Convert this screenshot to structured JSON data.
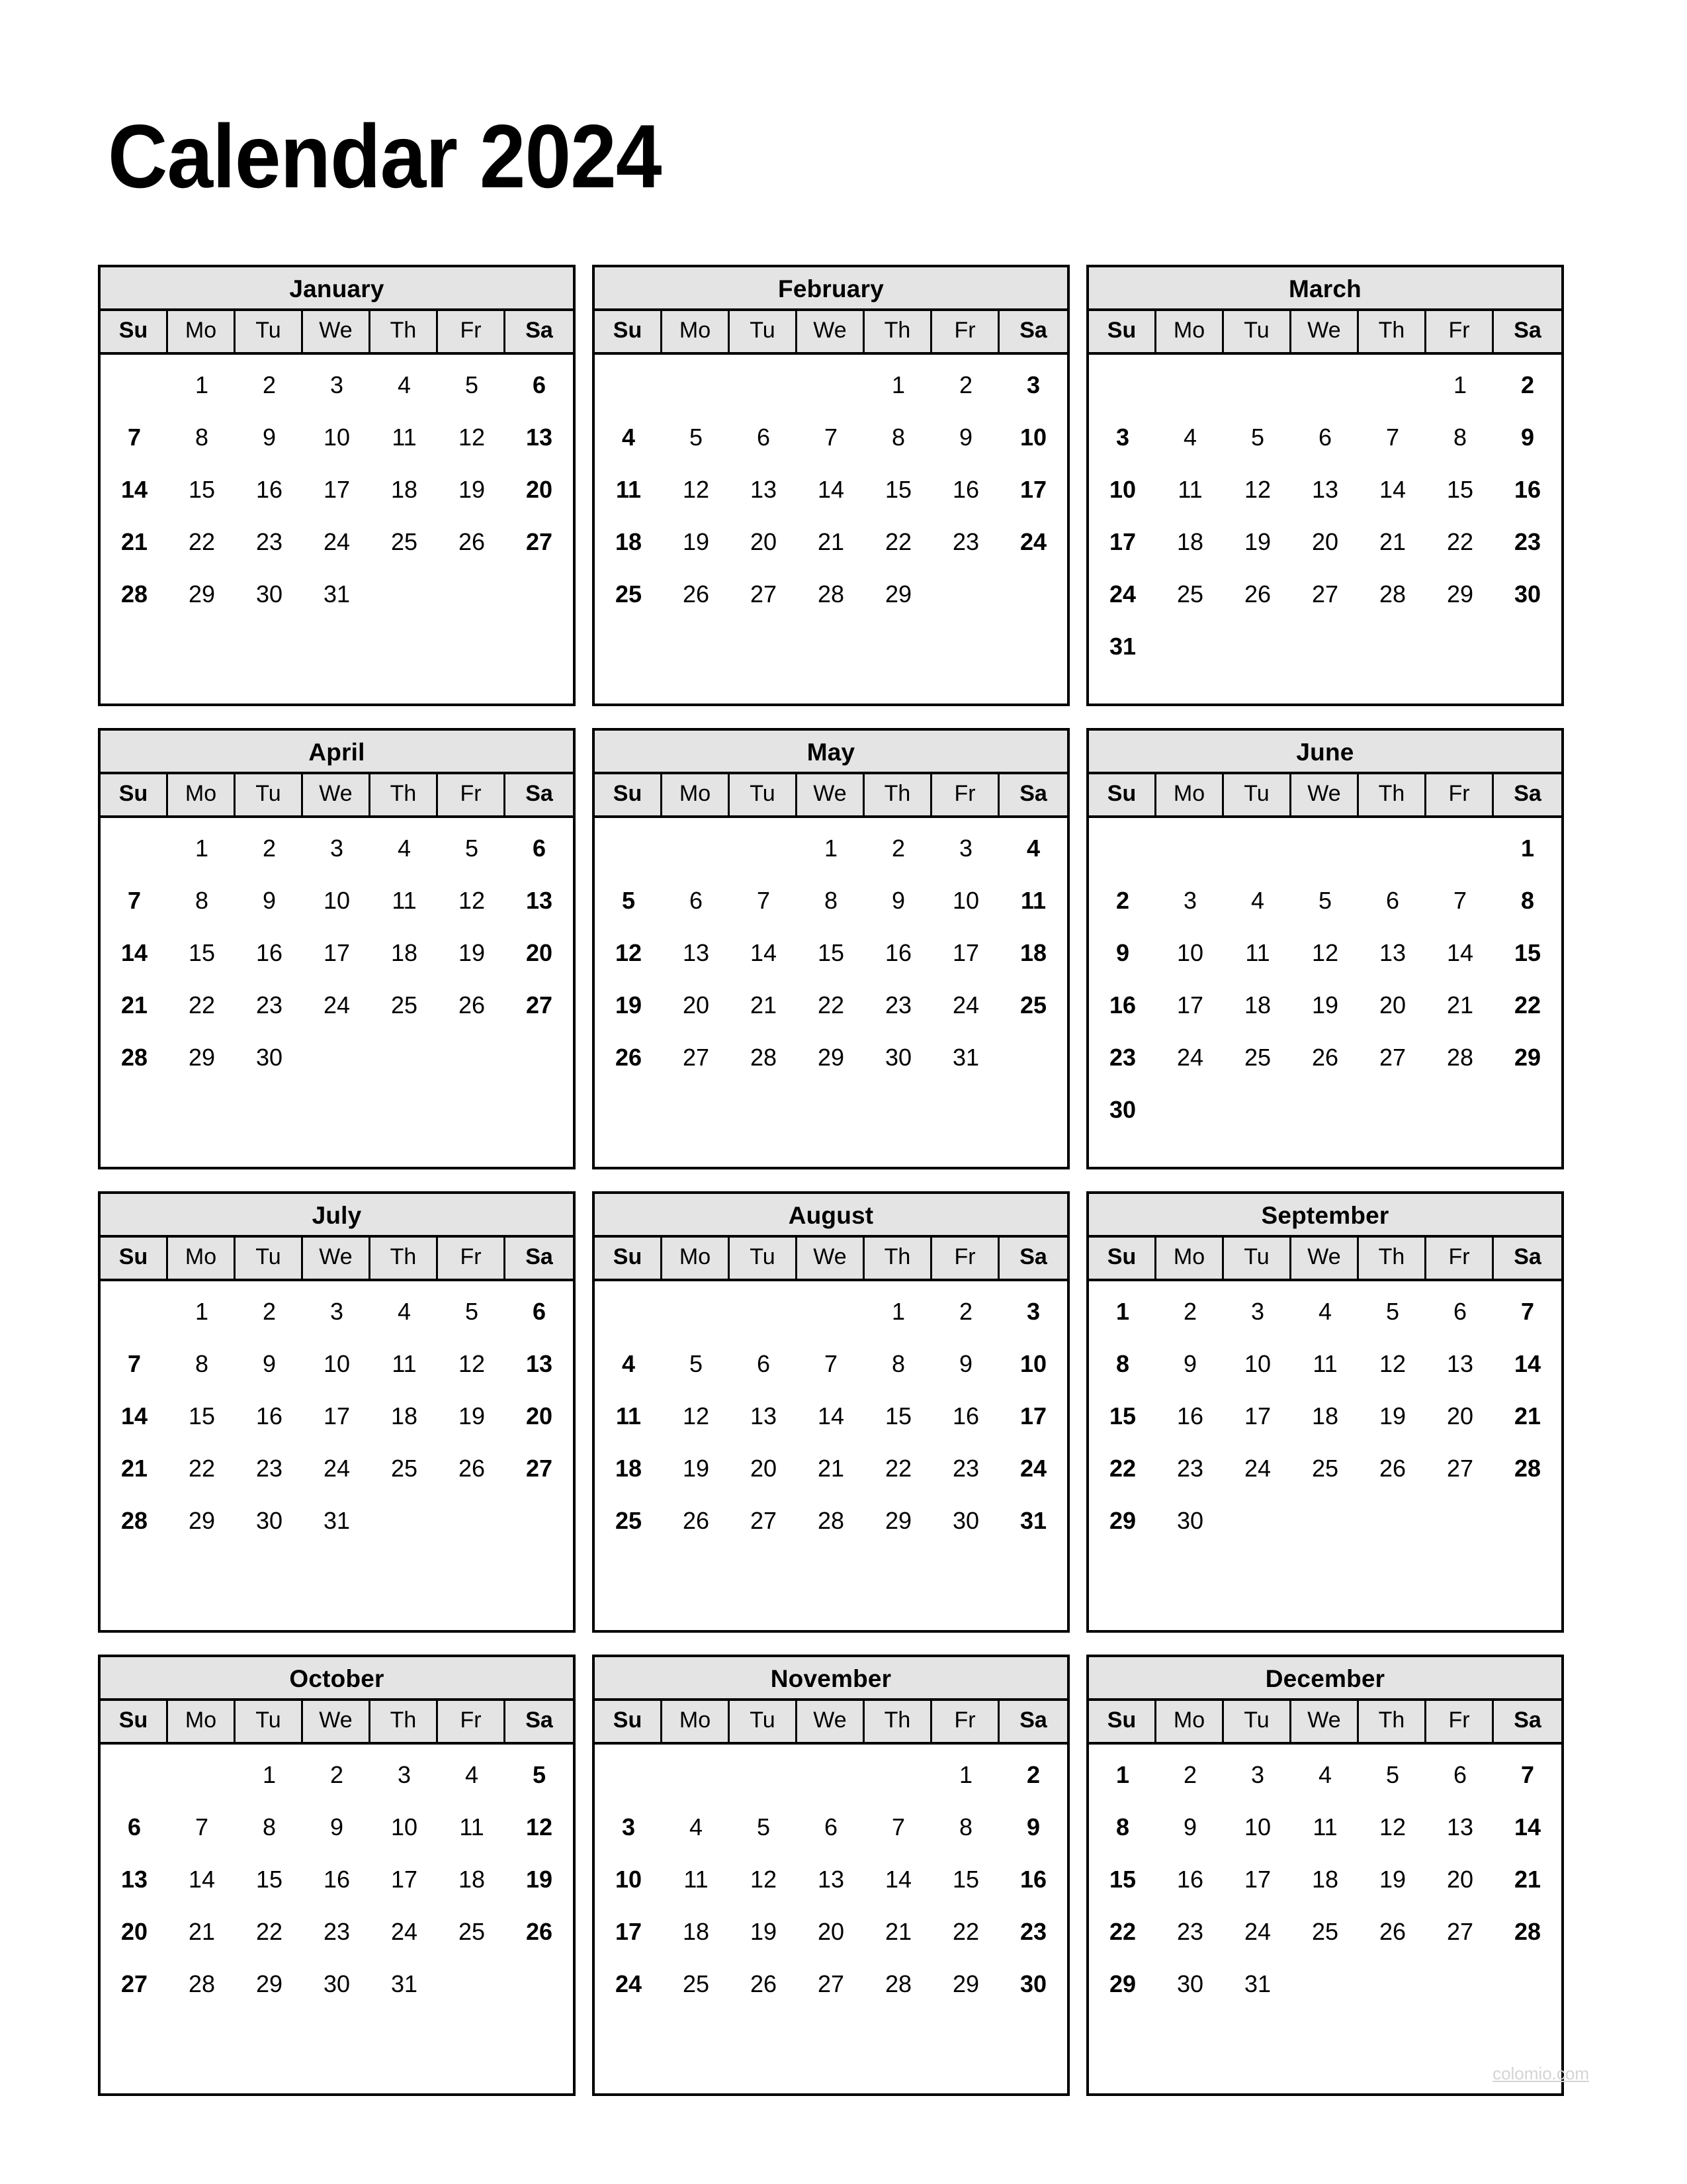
{
  "title": "Calendar 2024",
  "year": "2024",
  "watermark": "colomio.com",
  "colors": {
    "header_fill": "#e4e4e4",
    "border": "#000000",
    "text": "#000000",
    "watermark": "#d4d4d4"
  },
  "weekday_headers": [
    "Su",
    "Mo",
    "Tu",
    "We",
    "Th",
    "Fr",
    "Sa"
  ],
  "weekend_columns": [
    0,
    6
  ],
  "chart_data": {
    "type": "table",
    "title": "Calendar 2024",
    "first_day_of_week": "Sunday",
    "months": [
      {
        "name": "January",
        "index": 1,
        "days_in_month": 31,
        "first_weekday_index": 1,
        "weeks": [
          [
            "",
            "1",
            "2",
            "3",
            "4",
            "5",
            "6"
          ],
          [
            "7",
            "8",
            "9",
            "10",
            "11",
            "12",
            "13"
          ],
          [
            "14",
            "15",
            "16",
            "17",
            "18",
            "19",
            "20"
          ],
          [
            "21",
            "22",
            "23",
            "24",
            "25",
            "26",
            "27"
          ],
          [
            "28",
            "29",
            "30",
            "31",
            "",
            "",
            ""
          ],
          [
            "",
            "",
            "",
            "",
            "",
            "",
            ""
          ]
        ]
      },
      {
        "name": "February",
        "index": 2,
        "days_in_month": 29,
        "first_weekday_index": 4,
        "weeks": [
          [
            "",
            "",
            "",
            "",
            "1",
            "2",
            "3"
          ],
          [
            "4",
            "5",
            "6",
            "7",
            "8",
            "9",
            "10"
          ],
          [
            "11",
            "12",
            "13",
            "14",
            "15",
            "16",
            "17"
          ],
          [
            "18",
            "19",
            "20",
            "21",
            "22",
            "23",
            "24"
          ],
          [
            "25",
            "26",
            "27",
            "28",
            "29",
            "",
            ""
          ],
          [
            "",
            "",
            "",
            "",
            "",
            "",
            ""
          ]
        ]
      },
      {
        "name": "March",
        "index": 3,
        "days_in_month": 31,
        "first_weekday_index": 5,
        "weeks": [
          [
            "",
            "",
            "",
            "",
            "",
            "1",
            "2"
          ],
          [
            "3",
            "4",
            "5",
            "6",
            "7",
            "8",
            "9"
          ],
          [
            "10",
            "11",
            "12",
            "13",
            "14",
            "15",
            "16"
          ],
          [
            "17",
            "18",
            "19",
            "20",
            "21",
            "22",
            "23"
          ],
          [
            "24",
            "25",
            "26",
            "27",
            "28",
            "29",
            "30"
          ],
          [
            "31",
            "",
            "",
            "",
            "",
            "",
            ""
          ]
        ]
      },
      {
        "name": "April",
        "index": 4,
        "days_in_month": 30,
        "first_weekday_index": 1,
        "weeks": [
          [
            "",
            "1",
            "2",
            "3",
            "4",
            "5",
            "6"
          ],
          [
            "7",
            "8",
            "9",
            "10",
            "11",
            "12",
            "13"
          ],
          [
            "14",
            "15",
            "16",
            "17",
            "18",
            "19",
            "20"
          ],
          [
            "21",
            "22",
            "23",
            "24",
            "25",
            "26",
            "27"
          ],
          [
            "28",
            "29",
            "30",
            "",
            "",
            "",
            ""
          ],
          [
            "",
            "",
            "",
            "",
            "",
            "",
            ""
          ]
        ]
      },
      {
        "name": "May",
        "index": 5,
        "days_in_month": 31,
        "first_weekday_index": 3,
        "weeks": [
          [
            "",
            "",
            "",
            "1",
            "2",
            "3",
            "4"
          ],
          [
            "5",
            "6",
            "7",
            "8",
            "9",
            "10",
            "11"
          ],
          [
            "12",
            "13",
            "14",
            "15",
            "16",
            "17",
            "18"
          ],
          [
            "19",
            "20",
            "21",
            "22",
            "23",
            "24",
            "25"
          ],
          [
            "26",
            "27",
            "28",
            "29",
            "30",
            "31",
            ""
          ],
          [
            "",
            "",
            "",
            "",
            "",
            "",
            ""
          ]
        ]
      },
      {
        "name": "June",
        "index": 6,
        "days_in_month": 30,
        "first_weekday_index": 6,
        "weeks": [
          [
            "",
            "",
            "",
            "",
            "",
            "",
            "1"
          ],
          [
            "2",
            "3",
            "4",
            "5",
            "6",
            "7",
            "8"
          ],
          [
            "9",
            "10",
            "11",
            "12",
            "13",
            "14",
            "15"
          ],
          [
            "16",
            "17",
            "18",
            "19",
            "20",
            "21",
            "22"
          ],
          [
            "23",
            "24",
            "25",
            "26",
            "27",
            "28",
            "29"
          ],
          [
            "30",
            "",
            "",
            "",
            "",
            "",
            ""
          ]
        ]
      },
      {
        "name": "July",
        "index": 7,
        "days_in_month": 31,
        "first_weekday_index": 1,
        "weeks": [
          [
            "",
            "1",
            "2",
            "3",
            "4",
            "5",
            "6"
          ],
          [
            "7",
            "8",
            "9",
            "10",
            "11",
            "12",
            "13"
          ],
          [
            "14",
            "15",
            "16",
            "17",
            "18",
            "19",
            "20"
          ],
          [
            "21",
            "22",
            "23",
            "24",
            "25",
            "26",
            "27"
          ],
          [
            "28",
            "29",
            "30",
            "31",
            "",
            "",
            ""
          ],
          [
            "",
            "",
            "",
            "",
            "",
            "",
            ""
          ]
        ]
      },
      {
        "name": "August",
        "index": 8,
        "days_in_month": 31,
        "first_weekday_index": 4,
        "weeks": [
          [
            "",
            "",
            "",
            "",
            "1",
            "2",
            "3"
          ],
          [
            "4",
            "5",
            "6",
            "7",
            "8",
            "9",
            "10"
          ],
          [
            "11",
            "12",
            "13",
            "14",
            "15",
            "16",
            "17"
          ],
          [
            "18",
            "19",
            "20",
            "21",
            "22",
            "23",
            "24"
          ],
          [
            "25",
            "26",
            "27",
            "28",
            "29",
            "30",
            "31"
          ],
          [
            "",
            "",
            "",
            "",
            "",
            "",
            ""
          ]
        ]
      },
      {
        "name": "September",
        "index": 9,
        "days_in_month": 30,
        "first_weekday_index": 0,
        "weeks": [
          [
            "1",
            "2",
            "3",
            "4",
            "5",
            "6",
            "7"
          ],
          [
            "8",
            "9",
            "10",
            "11",
            "12",
            "13",
            "14"
          ],
          [
            "15",
            "16",
            "17",
            "18",
            "19",
            "20",
            "21"
          ],
          [
            "22",
            "23",
            "24",
            "25",
            "26",
            "27",
            "28"
          ],
          [
            "29",
            "30",
            "",
            "",
            "",
            "",
            ""
          ],
          [
            "",
            "",
            "",
            "",
            "",
            "",
            ""
          ]
        ]
      },
      {
        "name": "October",
        "index": 10,
        "days_in_month": 31,
        "first_weekday_index": 2,
        "weeks": [
          [
            "",
            "",
            "1",
            "2",
            "3",
            "4",
            "5"
          ],
          [
            "6",
            "7",
            "8",
            "9",
            "10",
            "11",
            "12"
          ],
          [
            "13",
            "14",
            "15",
            "16",
            "17",
            "18",
            "19"
          ],
          [
            "20",
            "21",
            "22",
            "23",
            "24",
            "25",
            "26"
          ],
          [
            "27",
            "28",
            "29",
            "30",
            "31",
            "",
            ""
          ],
          [
            "",
            "",
            "",
            "",
            "",
            "",
            ""
          ]
        ]
      },
      {
        "name": "November",
        "index": 11,
        "days_in_month": 30,
        "first_weekday_index": 5,
        "weeks": [
          [
            "",
            "",
            "",
            "",
            "",
            "1",
            "2"
          ],
          [
            "3",
            "4",
            "5",
            "6",
            "7",
            "8",
            "9"
          ],
          [
            "10",
            "11",
            "12",
            "13",
            "14",
            "15",
            "16"
          ],
          [
            "17",
            "18",
            "19",
            "20",
            "21",
            "22",
            "23"
          ],
          [
            "24",
            "25",
            "26",
            "27",
            "28",
            "29",
            "30"
          ],
          [
            "",
            "",
            "",
            "",
            "",
            "",
            ""
          ]
        ]
      },
      {
        "name": "December",
        "index": 12,
        "days_in_month": 31,
        "first_weekday_index": 0,
        "weeks": [
          [
            "1",
            "2",
            "3",
            "4",
            "5",
            "6",
            "7"
          ],
          [
            "8",
            "9",
            "10",
            "11",
            "12",
            "13",
            "14"
          ],
          [
            "15",
            "16",
            "17",
            "18",
            "19",
            "20",
            "21"
          ],
          [
            "22",
            "23",
            "24",
            "25",
            "26",
            "27",
            "28"
          ],
          [
            "29",
            "30",
            "31",
            "",
            "",
            "",
            ""
          ],
          [
            "",
            "",
            "",
            "",
            "",
            "",
            ""
          ]
        ]
      }
    ]
  }
}
